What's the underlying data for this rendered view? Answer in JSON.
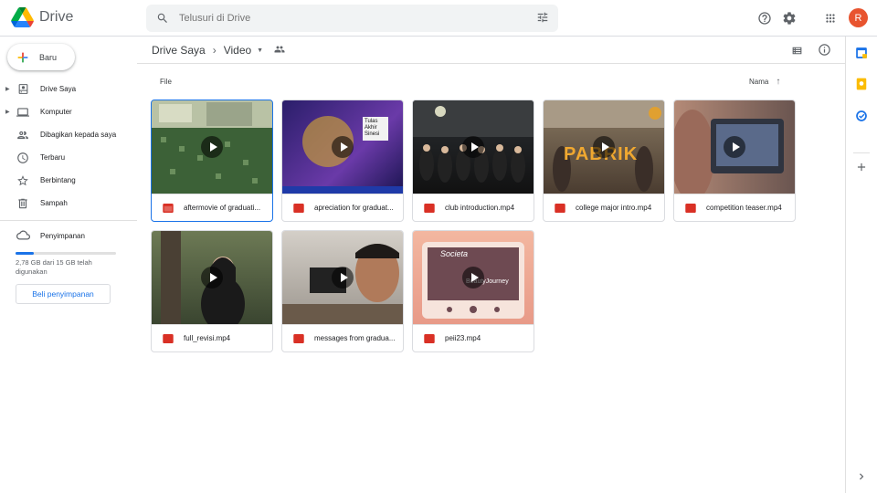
{
  "app": {
    "name": "Drive"
  },
  "search": {
    "placeholder": "Telusuri di Drive"
  },
  "account": {
    "initial": "R",
    "color": "#e8542f"
  },
  "new_button": {
    "label": "Baru"
  },
  "sidebar": {
    "items": [
      {
        "label": "Drive Saya",
        "icon": "my-drive-icon",
        "expandable": true
      },
      {
        "label": "Komputer",
        "icon": "computer-icon",
        "expandable": true
      },
      {
        "label": "Dibagikan kepada saya",
        "icon": "shared-icon",
        "expandable": false
      },
      {
        "label": "Terbaru",
        "icon": "clock-icon",
        "expandable": false
      },
      {
        "label": "Berbintang",
        "icon": "star-icon",
        "expandable": false
      },
      {
        "label": "Sampah",
        "icon": "trash-icon",
        "expandable": false
      }
    ]
  },
  "storage": {
    "label": "Penyimpanan",
    "used_fraction": 0.185,
    "usage_text": "2,78 GB dari 15 GB telah digunakan",
    "buy_label": "Beli penyimpanan"
  },
  "breadcrumb": {
    "root": "Drive Saya",
    "current": "Video"
  },
  "files_section": {
    "label": "File",
    "sort_label": "Nama"
  },
  "files": [
    {
      "name": "aftermovie of graduati...",
      "selected": true
    },
    {
      "name": "apreciation for graduat...",
      "selected": false
    },
    {
      "name": "club introduction.mp4",
      "selected": false
    },
    {
      "name": "college major intro.mp4",
      "selected": false
    },
    {
      "name": "competition teaser.mp4",
      "selected": false
    },
    {
      "name": "full_revisi.mp4",
      "selected": false
    },
    {
      "name": "messages from gradua...",
      "selected": false
    },
    {
      "name": "peii23.mp4",
      "selected": false
    }
  ],
  "thumb_text": {
    "t2": "Tulas Akhir Sinesi",
    "t4": "PABRIK",
    "t8a": "Societa",
    "t8b": "BeautyJourney"
  },
  "colors": {
    "accent": "#1a73e8",
    "video_icon": "#d93025"
  }
}
